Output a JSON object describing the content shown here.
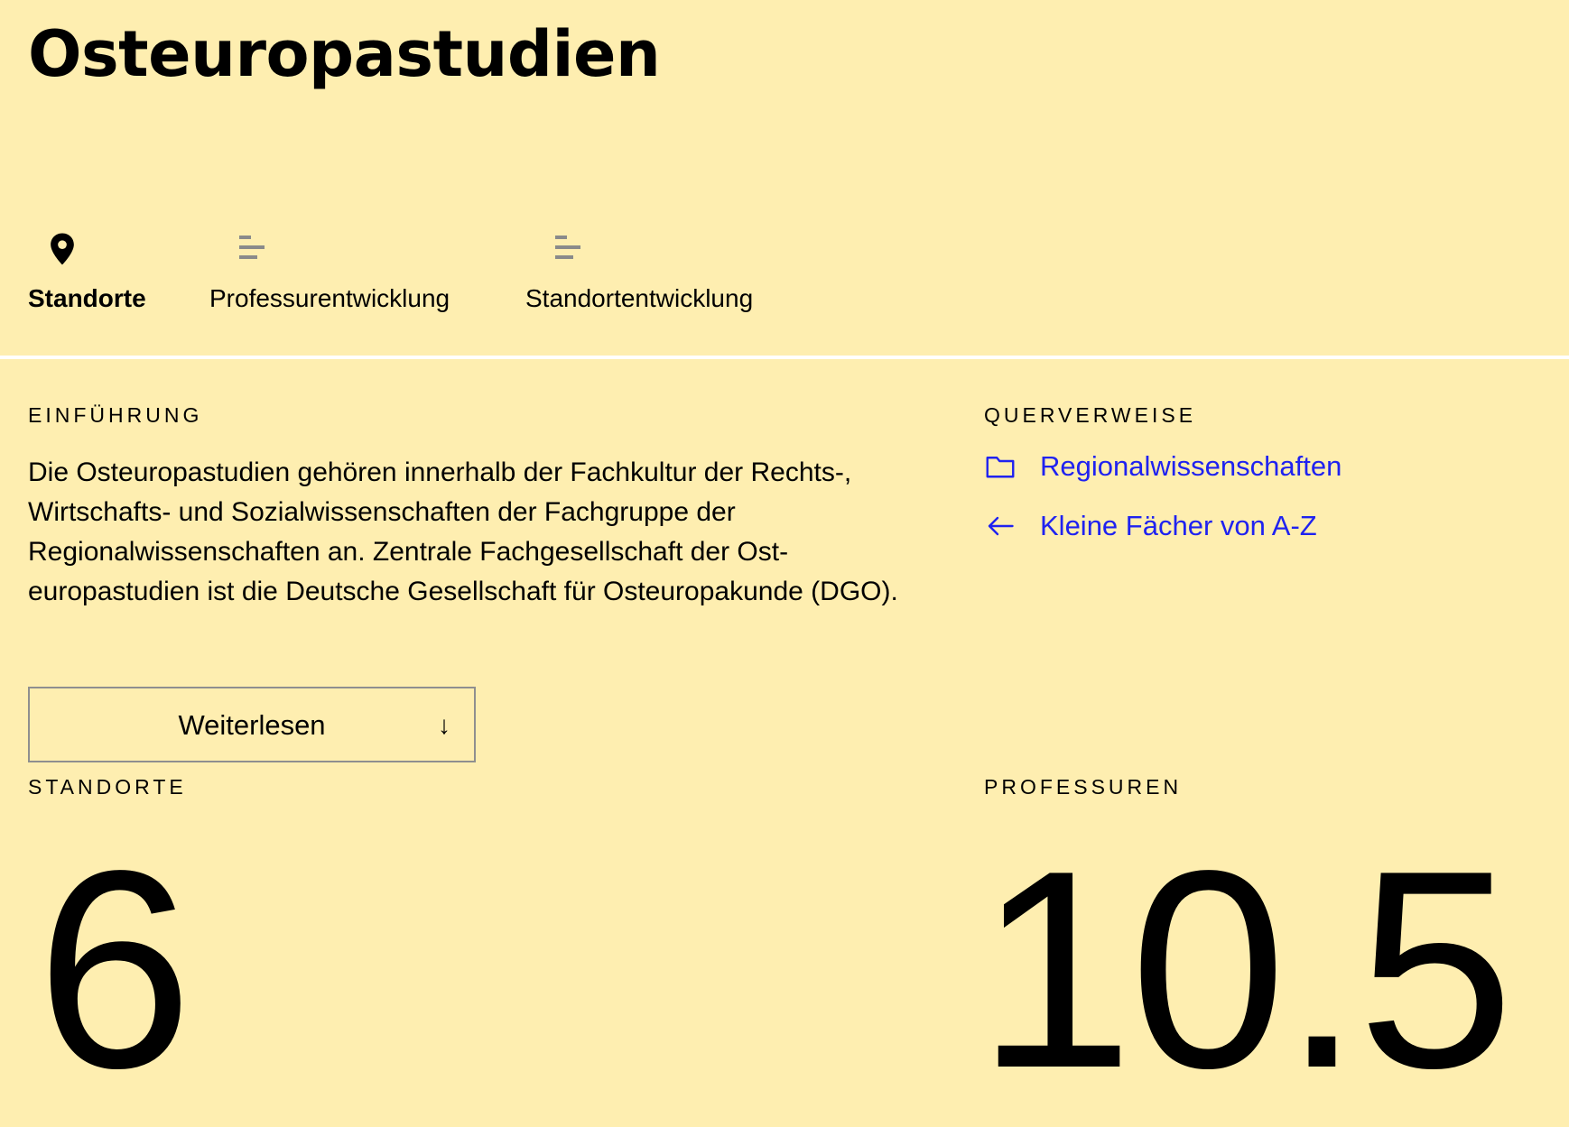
{
  "page": {
    "title": "Osteuropastudien"
  },
  "tabs": [
    {
      "label": "Standorte",
      "icon": "map-pin-icon",
      "active": true
    },
    {
      "label": "Professurentwicklung",
      "icon": "bar-chart-icon",
      "active": false
    },
    {
      "label": "Standortentwicklung",
      "icon": "bar-chart-icon",
      "active": false
    }
  ],
  "intro": {
    "heading": "EINFÜHRUNG",
    "text": "Die Osteuropastudien gehören innerhalb der Fachkultur der Rechts-, Wirtschafts- und Sozialwissenschaften der Fachgruppe der Regionalwissenschaften an. Zentrale Fachgesellschaft der Ost­europastudien ist die Deutsche Gesellschaft für Osteuropakunde (DGO).",
    "read_more_label": "Weiterlesen",
    "read_more_icon": "arrow-down-icon"
  },
  "cross_references": {
    "heading": "QUERVERWEISE",
    "links": [
      {
        "label": "Regionalwissenschaften",
        "icon": "folder-icon"
      },
      {
        "label": "Kleine Fächer von A-Z",
        "icon": "arrow-left-icon"
      }
    ]
  },
  "stats": {
    "standorte": {
      "label": "STANDORTE",
      "value": "6"
    },
    "professuren": {
      "label": "PROFESSUREN",
      "value": "10.5"
    }
  },
  "colors": {
    "background": "#feeeb0",
    "link": "#1f22f0",
    "divider": "#ffffff",
    "icon_muted": "#8a8a8a"
  }
}
